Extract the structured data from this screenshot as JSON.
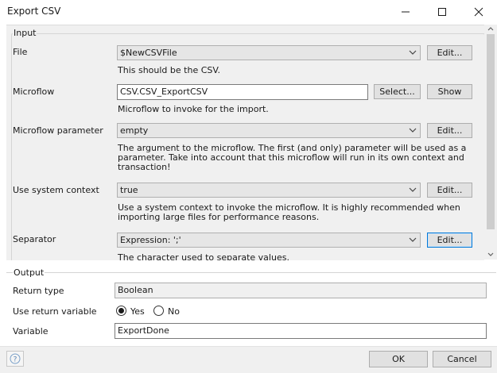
{
  "window": {
    "title": "Export CSV",
    "controls": [
      "minimize-icon",
      "maximize-icon",
      "close-icon"
    ]
  },
  "input": {
    "legend": "Input",
    "file": {
      "label": "File",
      "value": "$NewCSVFile",
      "edit_label": "Edit...",
      "help": "This should be the CSV."
    },
    "microflow": {
      "label": "Microflow",
      "value": "CSV.CSV_ExportCSV",
      "select_label": "Select...",
      "show_label": "Show",
      "help": "Microflow to invoke for the import."
    },
    "microflow_parameter": {
      "label": "Microflow parameter",
      "value": "empty",
      "edit_label": "Edit...",
      "help": "The argument to the microflow. The first (and only) parameter will be used as a parameter. Take into account that this microflow will run in its own context and transaction!"
    },
    "use_system_context": {
      "label": "Use system context",
      "value": "true",
      "edit_label": "Edit...",
      "help": "Use a system context to invoke the microflow. It is highly recommended when importing large files for performance reasons."
    },
    "separator": {
      "label": "Separator",
      "value": "Expression: ';'",
      "edit_label": "Edit...",
      "help": "The character used to separate values."
    }
  },
  "output": {
    "legend": "Output",
    "return_type": {
      "label": "Return type",
      "value": "Boolean"
    },
    "use_return_variable": {
      "label": "Use return variable",
      "options": [
        "Yes",
        "No"
      ],
      "selected": "Yes"
    },
    "variable": {
      "label": "Variable",
      "value": "ExportDone"
    }
  },
  "footer": {
    "ok_label": "OK",
    "cancel_label": "Cancel",
    "help_icon": "question-mark-icon"
  }
}
